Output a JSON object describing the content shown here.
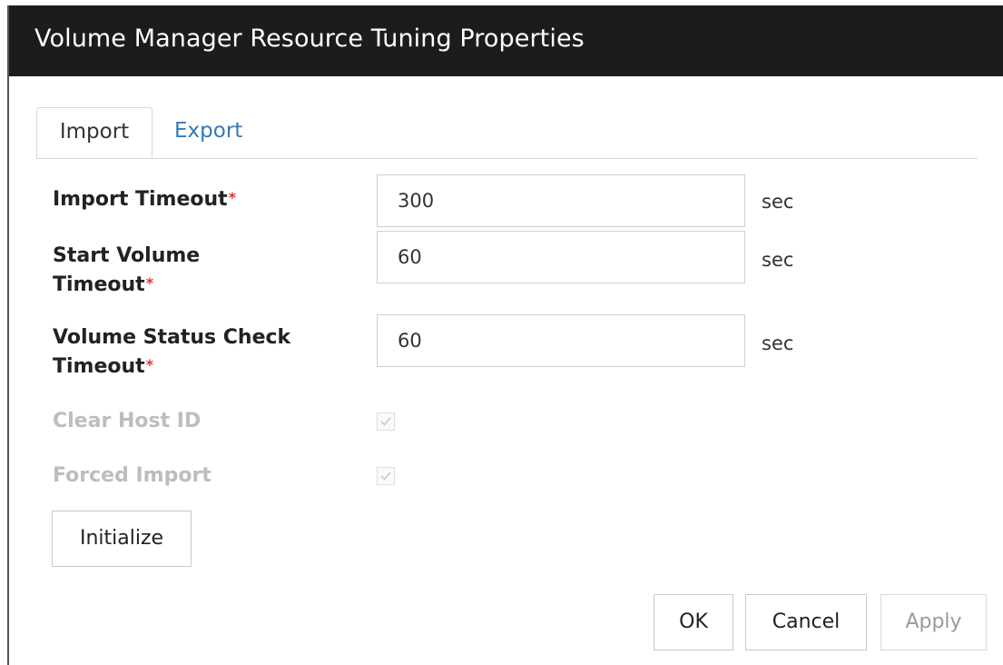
{
  "window": {
    "title": "Volume Manager Resource Tuning Properties"
  },
  "tabs": [
    {
      "label": "Import",
      "active": true
    },
    {
      "label": "Export",
      "active": false
    }
  ],
  "fields": {
    "import_timeout": {
      "label": "Import Timeout",
      "required_mark": "*",
      "value": "300",
      "unit": "sec"
    },
    "start_volume_timeout": {
      "label_line1": "Start Volume",
      "label_line2": "Timeout",
      "required_mark": "*",
      "value": "60",
      "unit": "sec"
    },
    "volume_status_check_timeout": {
      "label_line1": "Volume Status Check",
      "label_line2": "Timeout",
      "required_mark": "*",
      "value": "60",
      "unit": "sec"
    },
    "clear_host_id": {
      "label": "Clear Host ID",
      "checked": true,
      "disabled": true
    },
    "forced_import": {
      "label": "Forced Import",
      "checked": true,
      "disabled": true
    }
  },
  "buttons": {
    "initialize": "Initialize",
    "ok": "OK",
    "cancel": "Cancel",
    "apply": "Apply"
  },
  "colors": {
    "title_bar": "#1c1c1c",
    "required": "#e03434",
    "link": "#337ab7",
    "disabled_text": "#bdbdbd"
  }
}
